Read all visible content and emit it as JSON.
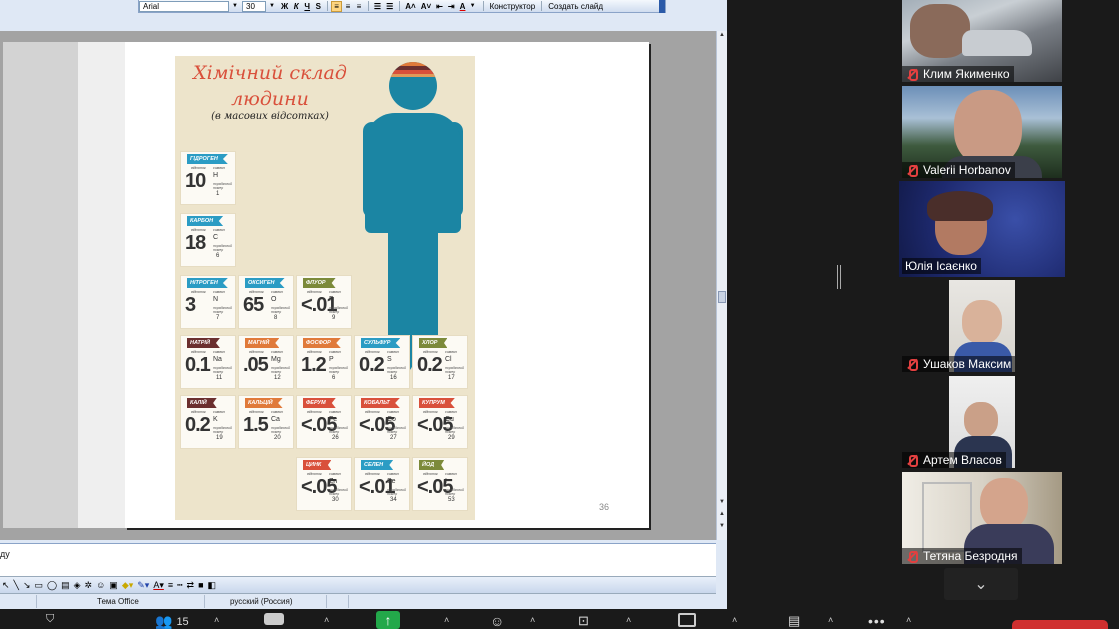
{
  "ppt": {
    "toolbar": {
      "font": "Arial",
      "size": "30",
      "bold": "Ж",
      "italic": "К",
      "underline": "Ч",
      "shadow": "S",
      "constructor": "Конструктор",
      "new_slide": "Создать слайд"
    },
    "slide_number": "36",
    "notes_text": "ду",
    "status": {
      "theme": "Тема Office",
      "language": "русский (Россия)"
    },
    "poster": {
      "title": "Хімічний склад людини",
      "subtitle": "(в масових відсотках)",
      "label_percent": "відсоток",
      "label_symbol": "символ",
      "label_number": "порядковий номер",
      "colors": {
        "title": "#d9503b",
        "figure": "#1b85a3",
        "background": "#ede4cb"
      },
      "elements": [
        {
          "name": "ГІДРОГЕН",
          "value": "10",
          "symbol": "H",
          "number": "1",
          "color": "#2b9cc4"
        },
        {
          "name": "КАРБОН",
          "value": "18",
          "symbol": "C",
          "number": "6",
          "color": "#2b9cc4"
        },
        {
          "name": "НІТРОГЕН",
          "value": "3",
          "symbol": "N",
          "number": "7",
          "color": "#2b9cc4"
        },
        {
          "name": "ОКСИГЕН",
          "value": "65",
          "symbol": "O",
          "number": "8",
          "color": "#2b9cc4"
        },
        {
          "name": "ФЛУОР",
          "value": "<.01",
          "symbol": "F",
          "number": "9",
          "color": "#7c8a3a"
        },
        {
          "name": "НАТРІЙ",
          "value": "0.1",
          "symbol": "Na",
          "number": "11",
          "color": "#6b2f2f"
        },
        {
          "name": "МАГНІЙ",
          "value": ".05",
          "symbol": "Mg",
          "number": "12",
          "color": "#e07a3a"
        },
        {
          "name": "ФОСФОР",
          "value": "1.2",
          "symbol": "P",
          "number": "6",
          "color": "#e07a3a"
        },
        {
          "name": "СУЛЬФУР",
          "value": "0.2",
          "symbol": "S",
          "number": "16",
          "color": "#2b9cc4"
        },
        {
          "name": "ХЛОР",
          "value": "0.2",
          "symbol": "Cl",
          "number": "17",
          "color": "#7c8a3a"
        },
        {
          "name": "КАЛІЙ",
          "value": "0.2",
          "symbol": "K",
          "number": "19",
          "color": "#6b2f2f"
        },
        {
          "name": "КАЛЬЦІЙ",
          "value": "1.5",
          "symbol": "Ca",
          "number": "20",
          "color": "#e07a3a"
        },
        {
          "name": "ФЕРУМ",
          "value": "<.05",
          "symbol": "Fe",
          "number": "26",
          "color": "#d9503b"
        },
        {
          "name": "КОБАЛЬТ",
          "value": "<.05",
          "symbol": "Co",
          "number": "27",
          "color": "#d9503b"
        },
        {
          "name": "КУПРУМ",
          "value": "<.05",
          "symbol": "Cu",
          "number": "29",
          "color": "#d9503b"
        },
        {
          "name": "ЦИНК",
          "value": "<.05",
          "symbol": "Zn",
          "number": "30",
          "color": "#d9503b"
        },
        {
          "name": "СЕЛЕН",
          "value": "<.01",
          "symbol": "Se",
          "number": "34",
          "color": "#2b9cc4"
        },
        {
          "name": "ЙОД",
          "value": "<.05",
          "symbol": "I",
          "number": "53",
          "color": "#7c8a3a"
        }
      ]
    }
  },
  "participants": [
    {
      "name": "Клим Якименко",
      "muted": true
    },
    {
      "name": "Valerii Horbanov",
      "muted": true
    },
    {
      "name": "Юлія Ісаєнко",
      "muted": false,
      "active": true
    },
    {
      "name": "Ушаков Максим",
      "muted": true
    },
    {
      "name": "Артем Власов",
      "muted": true
    },
    {
      "name": "Тетяна Безродня",
      "muted": true
    }
  ],
  "zoom_bar": {
    "participants_count": "15"
  }
}
